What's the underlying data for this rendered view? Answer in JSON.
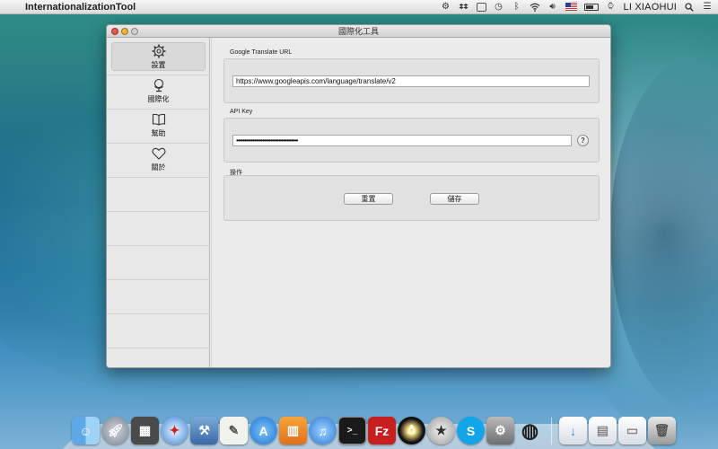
{
  "menubar": {
    "apple_glyph": "",
    "app_name": "InternationalizationTool",
    "user_name": "LI XIAOHUI",
    "status_icons": [
      "gear-icon",
      "dropbox-icon",
      "window-icon",
      "time-machine-icon",
      "bluetooth-icon",
      "wifi-icon",
      "volume-icon",
      "us-flag-icon",
      "battery-icon",
      "clock-icon",
      "search-icon",
      "notifications-icon"
    ]
  },
  "window": {
    "title": "國際化工具"
  },
  "sidebar": {
    "items": [
      {
        "label": "設置",
        "icon": "gear-icon",
        "active": true
      },
      {
        "label": "國際化",
        "icon": "globe-stand-icon",
        "active": false
      },
      {
        "label": "幫助",
        "icon": "book-icon",
        "active": false
      },
      {
        "label": "關於",
        "icon": "heart-icon",
        "active": false
      }
    ]
  },
  "settings": {
    "url_group_label": "Google Translate URL",
    "url_value": "https://www.googleapis.com/language/translate/v2",
    "api_group_label": "API Key",
    "api_key_masked": "••••••••••••••••••••••••••••••••••••••",
    "help_label": "?",
    "actions_group_label": "操作",
    "reset_label": "重置",
    "save_label": "儲存"
  },
  "dock": {
    "items": [
      "finder-icon",
      "launchpad-icon",
      "mission-control-icon",
      "safari-icon",
      "xcode-icon",
      "textedit-icon",
      "app-store-icon",
      "ibooks-icon",
      "itunes-icon",
      "terminal-icon",
      "filezilla-icon",
      "qq-icon",
      "instruments-icon",
      "skype-icon",
      "system-preferences-icon",
      "globe-icon",
      "downloads-stack-icon",
      "documents-stack-icon",
      "desktop-stack-icon",
      "trash-icon"
    ]
  },
  "colors": {
    "accent": "#3b83d8",
    "window_bg": "#ececec"
  }
}
